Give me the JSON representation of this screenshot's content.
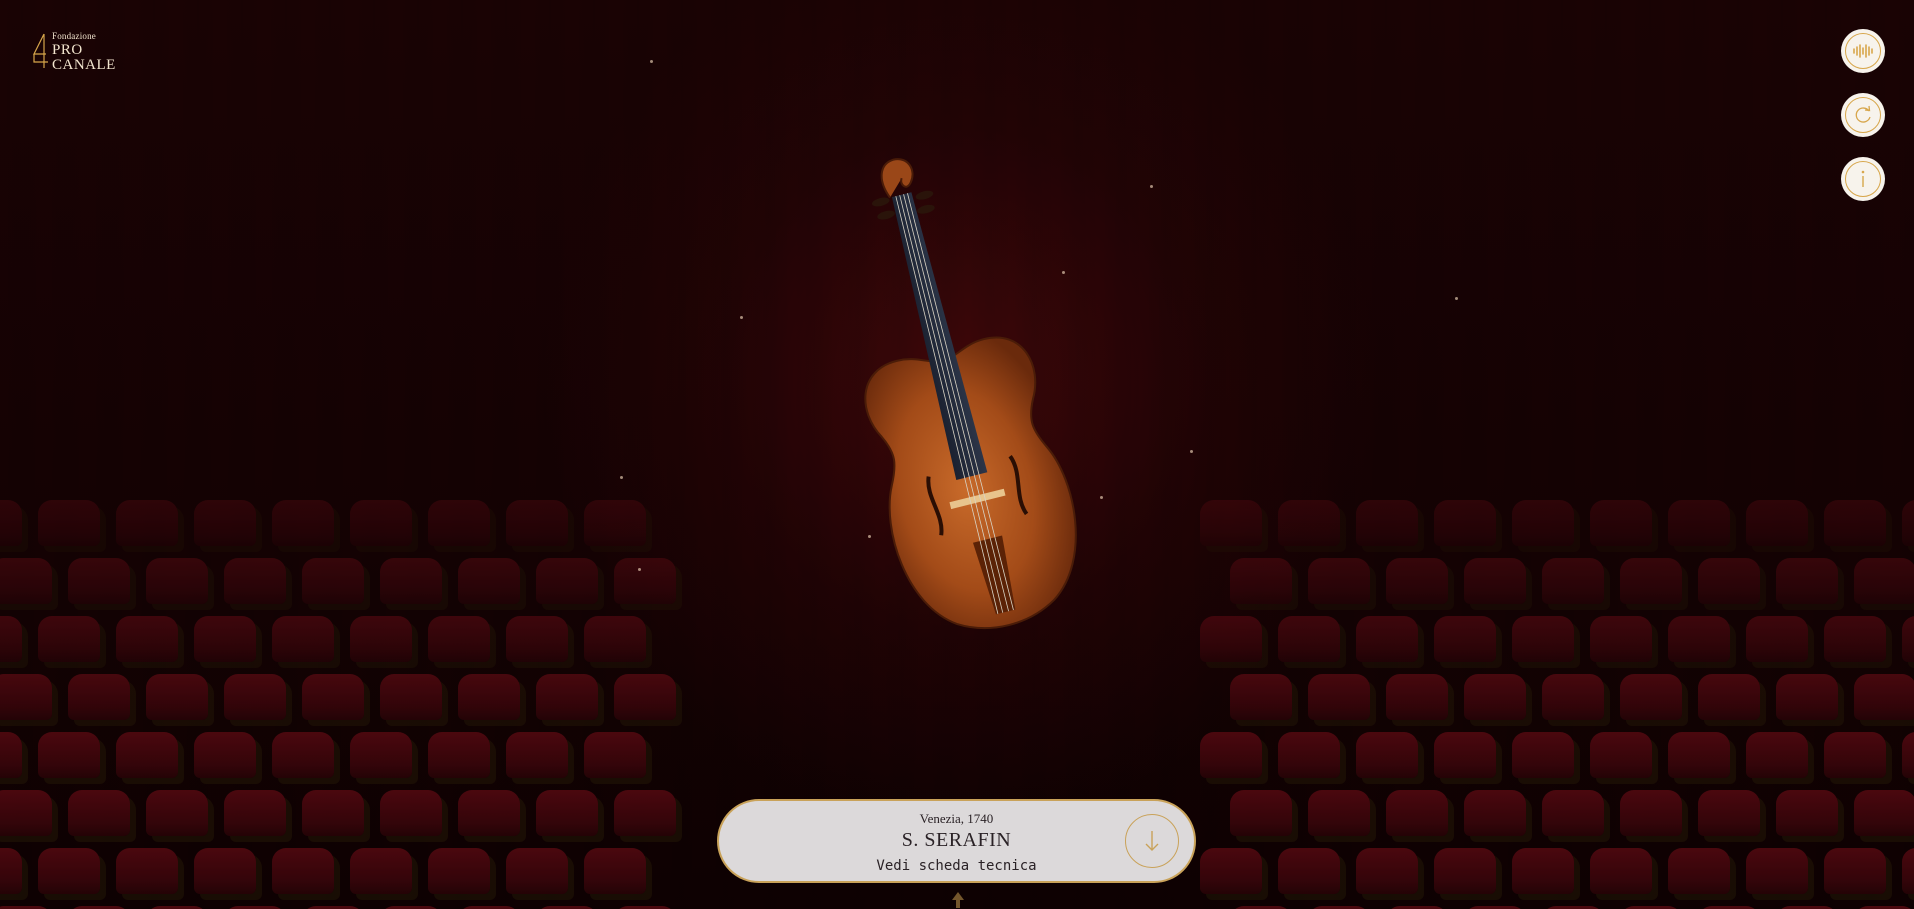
{
  "logo": {
    "small": "Fondazione",
    "line1": "PRO",
    "line2": "CANALE"
  },
  "controls": [
    {
      "name": "audio-button",
      "icon": "audio-wave-icon"
    },
    {
      "name": "rotate-button",
      "icon": "rotate-icon"
    },
    {
      "name": "info-button",
      "icon": "info-icon"
    }
  ],
  "instrument": {
    "place_year": "Venezia, 1740",
    "maker": "S. SERAFIN",
    "details_link": "Vedi scheda tecnica"
  },
  "colors": {
    "accent": "#c9a259",
    "card_bg": "#dcd9da",
    "background": "#120203"
  }
}
